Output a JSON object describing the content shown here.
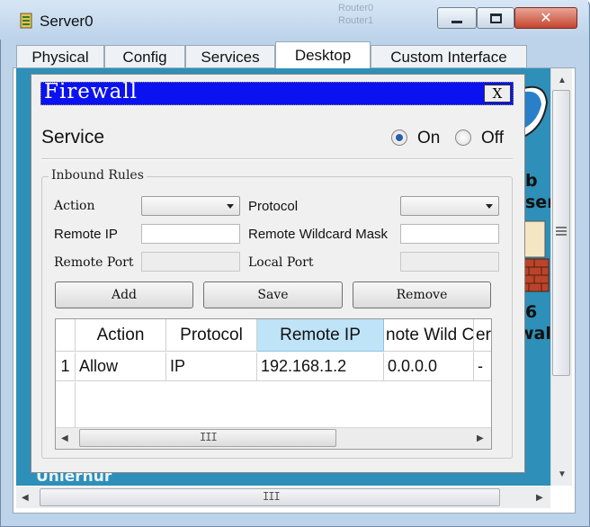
{
  "window": {
    "title": "Server0",
    "background_network_text": [
      "Router0",
      "Router1"
    ]
  },
  "tabs": [
    {
      "label": "Physical",
      "active": false
    },
    {
      "label": "Config",
      "active": false
    },
    {
      "label": "Services",
      "active": false
    },
    {
      "label": "Desktop",
      "active": true
    },
    {
      "label": "Custom Interface",
      "active": false
    }
  ],
  "desktop_fragments": {
    "icon1_label": "b",
    "icon1_sub": "ser",
    "icon2_label": "6",
    "icon2_sub": "wall",
    "cut_text": "Uniernur"
  },
  "dialog": {
    "title": "Firewall",
    "close_label": "X",
    "service_label": "Service",
    "service_on_label": "On",
    "service_off_label": "Off",
    "service_state": "On",
    "inbound_rules": {
      "legend": "Inbound Rules",
      "action_label": "Action",
      "action_value": "",
      "protocol_label": "Protocol",
      "protocol_value": "",
      "remote_ip_label": "Remote IP",
      "remote_ip_value": "",
      "remote_wildcard_label": "Remote Wildcard Mask",
      "remote_wildcard_value": "",
      "remote_port_label": "Remote Port",
      "local_port_label": "Local Port",
      "add_label": "Add",
      "save_label": "Save",
      "remove_label": "Remove"
    },
    "table": {
      "columns": [
        "",
        "Action",
        "Protocol",
        "Remote IP",
        "note Wild C",
        "er"
      ],
      "rows": [
        [
          "1",
          "Allow",
          "IP",
          "192.168.1.2",
          "0.0.0.0",
          "-"
        ]
      ]
    }
  },
  "colors": {
    "dialog_title_bar": "#0b12f0",
    "desktop_background": "#2e8fb8",
    "selected_column_header": "#bfe3f7",
    "window_chrome": "#bcd3ea"
  },
  "icons": {
    "app": "server-icon",
    "desktop_icon_1": "web-browser-icon",
    "desktop_icon_2": "firewall-brick-icon"
  },
  "scrollbar_grip": "III"
}
